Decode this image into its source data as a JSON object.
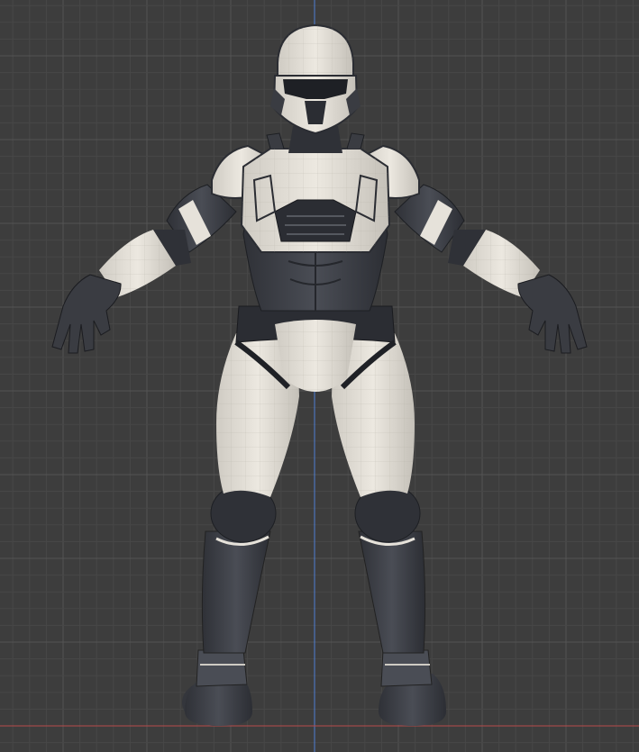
{
  "viewport": {
    "background_color": "#3d3d3d",
    "grid_minor_color": "#474747",
    "grid_major_color": "#545454",
    "axis_y_color": "#4e7fd4",
    "axis_x_color": "#b84a4a"
  },
  "model": {
    "armor_white": "#e6e2da",
    "armor_white_shade": "#bdb9b1",
    "suit_dark": "#3c3f46",
    "suit_darker": "#2b2d33",
    "visor_color": "#1e2025",
    "wireframe_color": "#a9a59d"
  }
}
